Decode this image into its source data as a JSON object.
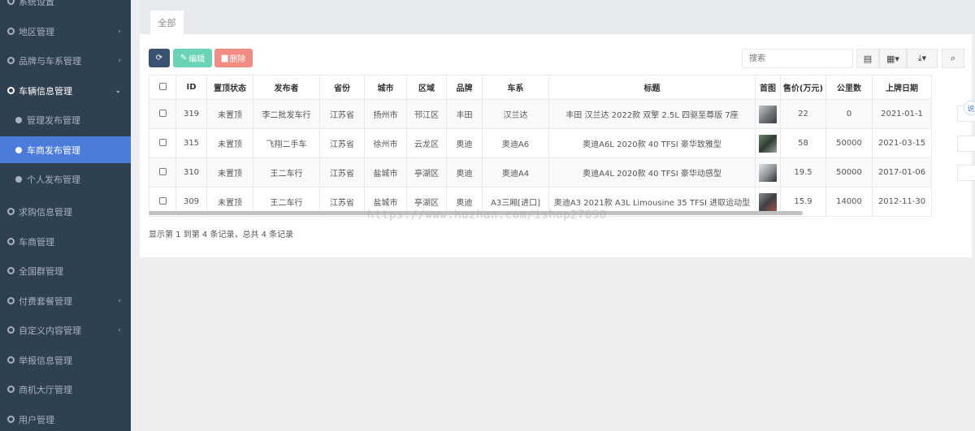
{
  "sidebar": {
    "items": [
      {
        "label": "系统设置",
        "type": "group",
        "chevron": ""
      },
      {
        "label": "地区管理",
        "type": "group",
        "chevron": "‹"
      },
      {
        "label": "品牌与车系管理",
        "type": "group",
        "chevron": "‹"
      },
      {
        "label": "车辆信息管理",
        "type": "group-open",
        "chevron": "⌄"
      },
      {
        "label": "管理发布管理",
        "type": "sub"
      },
      {
        "label": "车商发布管理",
        "type": "sub-active"
      },
      {
        "label": "个人发布管理",
        "type": "sub"
      },
      {
        "label": "求购信息管理",
        "type": "group",
        "chevron": ""
      },
      {
        "label": "车商管理",
        "type": "group",
        "chevron": ""
      },
      {
        "label": "全国群管理",
        "type": "group",
        "chevron": ""
      },
      {
        "label": "付费套餐管理",
        "type": "group",
        "chevron": "‹"
      },
      {
        "label": "自定义内容管理",
        "type": "group",
        "chevron": "‹"
      },
      {
        "label": "举报信息管理",
        "type": "group",
        "chevron": ""
      },
      {
        "label": "商机大厅管理",
        "type": "group",
        "chevron": ""
      },
      {
        "label": "用户管理",
        "type": "group",
        "chevron": ""
      }
    ]
  },
  "tabs": [
    {
      "label": "全部"
    }
  ],
  "toolbar": {
    "edit_label": "编辑",
    "delete_label": "删除",
    "search_placeholder": "搜索"
  },
  "table": {
    "columns": [
      "ID",
      "置顶状态",
      "发布者",
      "省份",
      "城市",
      "区域",
      "品牌",
      "车系",
      "标题",
      "首图",
      "售价(万元)",
      "公里数",
      "上牌日期"
    ],
    "rows": [
      [
        "319",
        "未置顶",
        "李二批发车行",
        "江苏省",
        "扬州市",
        "邗江区",
        "丰田",
        "汉兰达",
        "丰田 汉兰达 2022款 双擎 2.5L 四驱至尊版 7座",
        "",
        "22",
        "0",
        "2021-01-1"
      ],
      [
        "315",
        "未置顶",
        "飞翔二手车",
        "江苏省",
        "徐州市",
        "云龙区",
        "奥迪",
        "奥迪A6",
        "奥迪A6L 2020款 40 TFSI 豪华致雅型",
        "",
        "58",
        "50000",
        "2021-03-15"
      ],
      [
        "310",
        "未置顶",
        "王二车行",
        "江苏省",
        "盐城市",
        "亭湖区",
        "奥迪",
        "奥迪A4",
        "奥迪A4L 2020款 40 TFSI 豪华动感型",
        "",
        "19.5",
        "50000",
        "2017-01-06"
      ],
      [
        "309",
        "未置顶",
        "王二车行",
        "江苏省",
        "盐城市",
        "亭湖区",
        "奥迪",
        "A3三厢[进口]",
        "奥迪A3 2021款 A3L Limousine 35 TFSI 进取运动型",
        "",
        "15.9",
        "14000",
        "2012-11-30"
      ]
    ]
  },
  "summary": "显示第 1 到第 4 条记录，总共 4 条记录",
  "watermark": "https://www.huzhan.com/ishop27690",
  "colors": {
    "sidebar_bg": "#2f4050",
    "active": "#4b7bdb",
    "edit": "#6ad2b5",
    "delete": "#f28b83"
  }
}
